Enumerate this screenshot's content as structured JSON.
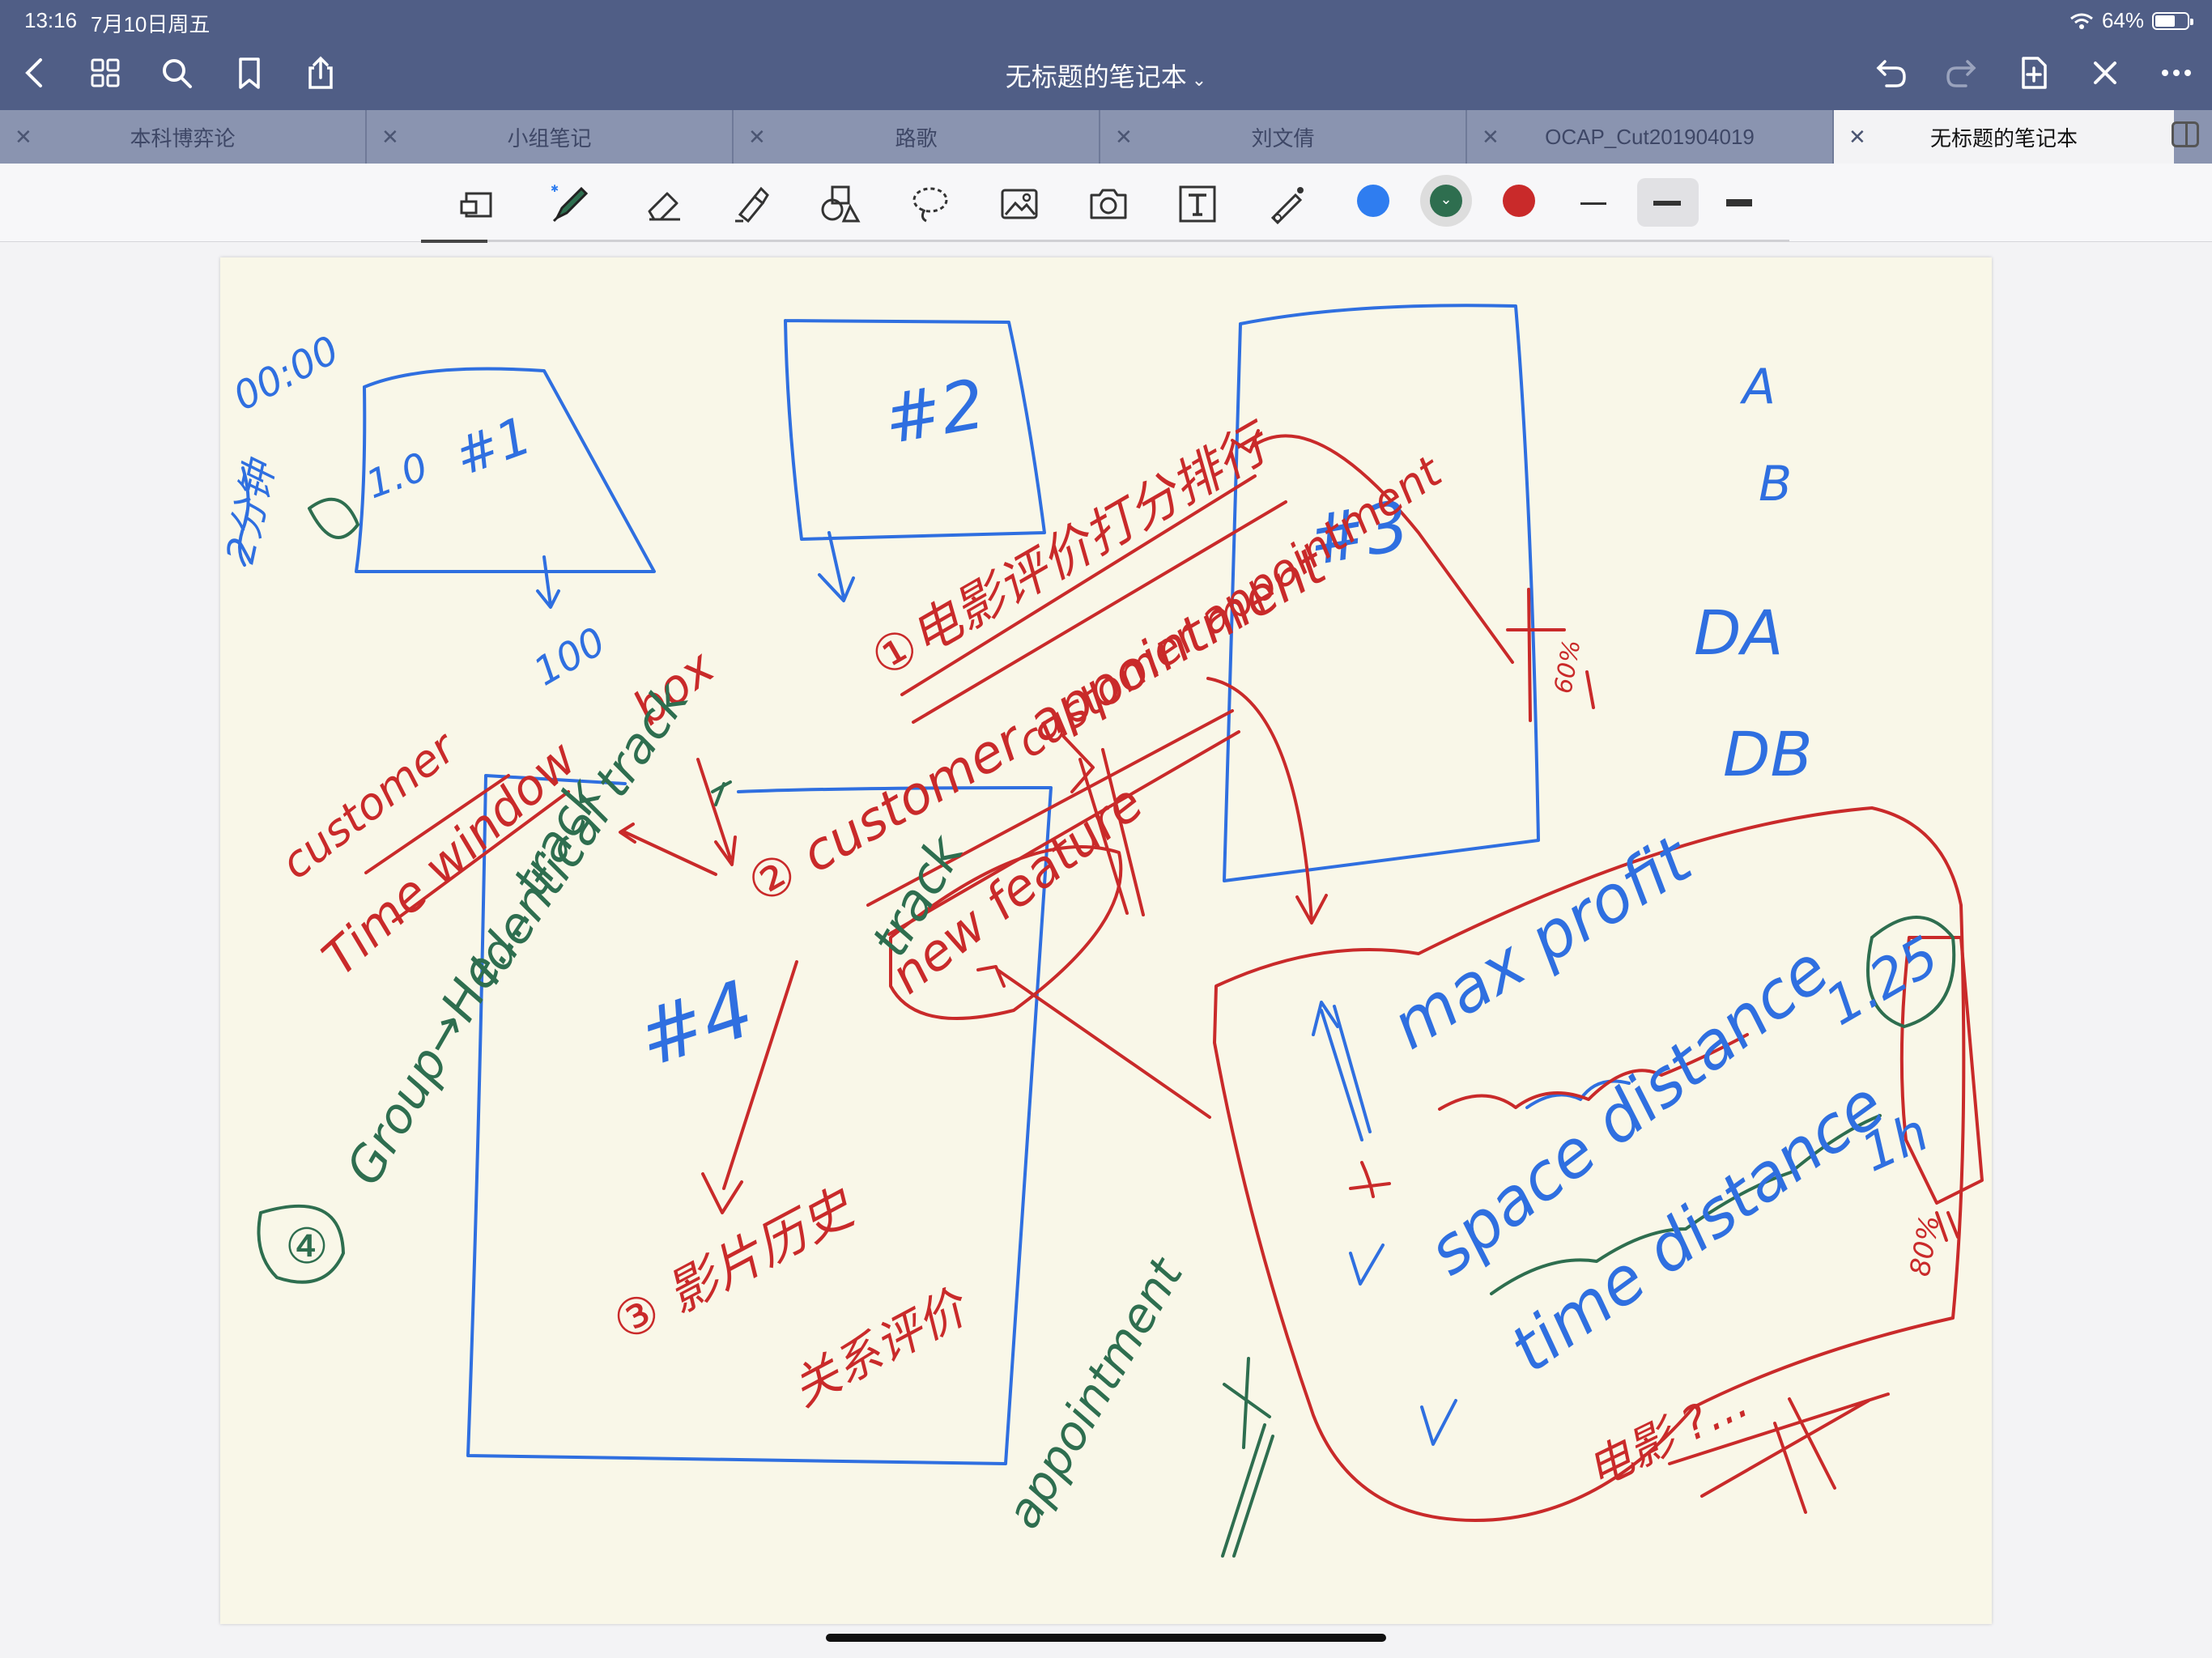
{
  "status": {
    "time": "13:16",
    "date": "7月10日周五",
    "battery": "64%",
    "battery_level": 0.64
  },
  "header": {
    "title": "无标题的笔记本",
    "back_icon": "chevron-left-icon",
    "grid_icon": "grid-icon",
    "search_icon": "search-icon",
    "bookmark_icon": "bookmark-icon",
    "share_icon": "share-icon",
    "undo_icon": "undo-icon",
    "redo_icon": "redo-icon",
    "add_page_icon": "add-page-icon",
    "close_icon": "close-icon",
    "more_icon": "more-icon"
  },
  "tabs": [
    {
      "label": "本科博弈论",
      "active": false
    },
    {
      "label": "小组笔记",
      "active": false
    },
    {
      "label": "路歌",
      "active": false
    },
    {
      "label": "刘文倩",
      "active": false
    },
    {
      "label": "OCAP_Cut201904019",
      "active": false
    },
    {
      "label": "无标题的笔记本",
      "active": true
    }
  ],
  "toolbar": {
    "tools": [
      "document-reader-icon",
      "pen-icon",
      "eraser-icon",
      "highlighter-icon",
      "shapes-icon",
      "lasso-icon",
      "image-icon",
      "camera-icon",
      "text-icon",
      "laser-pointer-icon"
    ],
    "colors": [
      "#2f7df0",
      "#2e6e4f",
      "#c92a2a"
    ],
    "selected_color": "#2e6e4f",
    "stroke_widths": [
      "thin",
      "medium",
      "thick"
    ],
    "selected_stroke": "medium"
  },
  "note": {
    "blue": [
      "00:00",
      "2分钟",
      "1.0",
      "#1",
      "100",
      "#2",
      "#3",
      "#4",
      "A",
      "B",
      "DA",
      "DB",
      "max profit",
      "space distance",
      "1.25",
      "time distance",
      "1h"
    ],
    "red": [
      "①电影评价打分排行",
      "customer appointment",
      "② customer appointment",
      "new feature",
      "customer",
      "Time window",
      "③ 影片历史",
      "关系评价",
      "80%",
      "电影 ?...",
      "60%",
      "box"
    ],
    "green": [
      "track",
      "Identical track",
      "Group→He.... track",
      "④",
      "appointment"
    ]
  }
}
